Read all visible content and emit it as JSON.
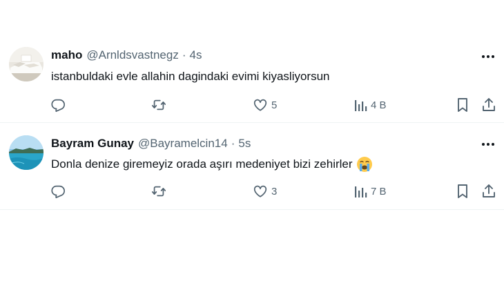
{
  "tweets": [
    {
      "name": "maho",
      "handle": "@Arnldsvastnegz",
      "separator": "·",
      "time": "4s",
      "text": "istanbuldaki evle allahin dagindaki evimi kiyasliyorsun",
      "avatar": "photo-of-white-bed-avatar",
      "actions": {
        "reply": "",
        "retweet": "",
        "likes": "5",
        "views": "4 B"
      }
    },
    {
      "name": "Bayram Gunay",
      "handle": "@Bayramelcin14",
      "separator": "·",
      "time": "5s",
      "text": "Donla denize giremeyiz orada aşırı medeniyet bizi zehirler",
      "emoji": "crying-face-emoji",
      "avatar": "sea-and-island-avatar",
      "actions": {
        "reply": "",
        "retweet": "",
        "likes": "3",
        "views": "7 B"
      }
    }
  ],
  "colors": {
    "text": "#0f1419",
    "muted": "#536471",
    "divider": "#eff3f4",
    "emoji_yellow": "#ffcb4c",
    "tear_blue": "#5dadec"
  },
  "icons": [
    "reply-icon",
    "retweet-icon",
    "like-icon",
    "views-icon",
    "bookmark-icon",
    "share-icon",
    "more-icon"
  ]
}
